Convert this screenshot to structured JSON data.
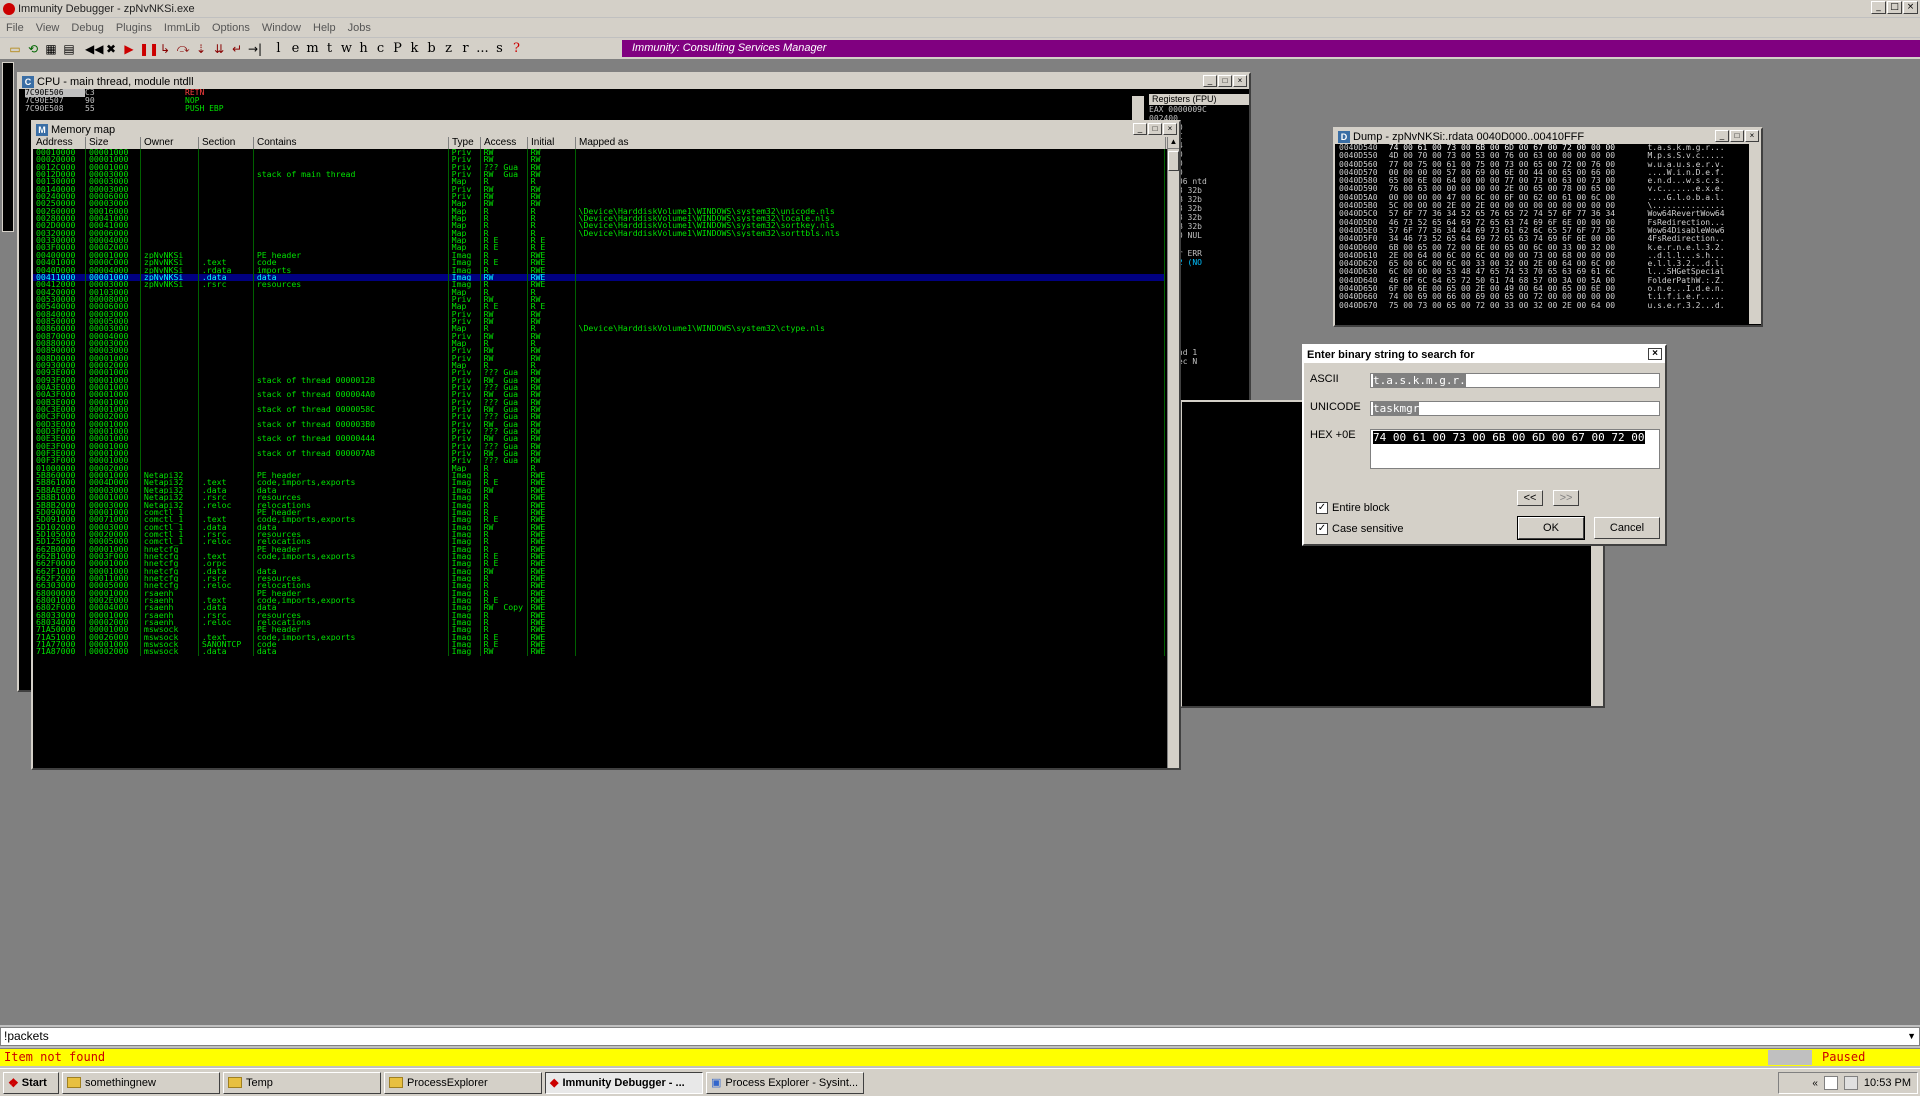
{
  "app": {
    "title": "Immunity Debugger - zpNvNKSi.exe"
  },
  "menu": [
    "File",
    "View",
    "Debug",
    "Plugins",
    "ImmLib",
    "Options",
    "Window",
    "Help",
    "Jobs"
  ],
  "toolbar": {
    "letters": [
      "l",
      "e",
      "m",
      "t",
      "w",
      "h",
      "c",
      "P",
      "k",
      "b",
      "z",
      "r",
      "...",
      "s",
      "?"
    ],
    "banner": "Immunity: Consulting Services Manager"
  },
  "cpu": {
    "title": "CPU - main thread, module ntdll",
    "lines": [
      {
        "addr": "7C90E506",
        "hex": "C3",
        "asm": "RETN"
      },
      {
        "addr": "7C90E507",
        "hex": "90",
        "asm": "NOP"
      },
      {
        "addr": "7C90E508",
        "hex": "55",
        "asm": "PUSH EBP"
      }
    ],
    "reg_header": "Registers (FPU)",
    "regs": [
      "EAX 0000009C",
      "002400",
      "0000000",
      "012FEEC",
      "012FEC4",
      "012FF60",
      "0000000",
      "FFDA000",
      "7C90E506 ntd",
      "ES 0023 32b",
      "CS 001B 32b",
      "SS 0023 32b",
      "DS 0023 32b",
      "FS 003B 32b",
      "GS 0000 NUL",
      "",
      "LastErr ERR",
      "0000302 (NO",
      "mpty",
      "mpty",
      "mpty",
      "mpty",
      "mpty",
      "mpty",
      "mpty",
      "mpty",
      "",
      "320  Cond 1",
      "27F  Prec N"
    ]
  },
  "memmap": {
    "title": "Memory map",
    "columns": [
      "Address",
      "Size",
      "Owner",
      "Section",
      "Contains",
      "Type",
      "Access",
      "Initial",
      "Mapped as"
    ],
    "rows": [
      [
        "00010000",
        "00001000",
        "",
        "",
        "",
        "Priv",
        "RW",
        "RW",
        ""
      ],
      [
        "00020000",
        "00001000",
        "",
        "",
        "",
        "Priv",
        "RW",
        "RW",
        ""
      ],
      [
        "0012C000",
        "00001000",
        "",
        "",
        "",
        "Priv",
        "??? Gua",
        "RW",
        ""
      ],
      [
        "0012D000",
        "00003000",
        "",
        "",
        "stack of main thread",
        "Priv",
        "RW  Gua",
        "RW",
        ""
      ],
      [
        "00130000",
        "00003000",
        "",
        "",
        "",
        "Map",
        "R",
        "R",
        ""
      ],
      [
        "00140000",
        "00003000",
        "",
        "",
        "",
        "Priv",
        "RW",
        "RW",
        ""
      ],
      [
        "00240000",
        "00006000",
        "",
        "",
        "",
        "Priv",
        "RW",
        "RW",
        ""
      ],
      [
        "00250000",
        "00003000",
        "",
        "",
        "",
        "Map",
        "RW",
        "RW",
        ""
      ],
      [
        "00260000",
        "00016000",
        "",
        "",
        "",
        "Map",
        "R",
        "R",
        "\\Device\\HarddiskVolume1\\WINDOWS\\system32\\unicode.nls"
      ],
      [
        "00280000",
        "00041000",
        "",
        "",
        "",
        "Map",
        "R",
        "R",
        "\\Device\\HarddiskVolume1\\WINDOWS\\system32\\locale.nls"
      ],
      [
        "002D0000",
        "00041000",
        "",
        "",
        "",
        "Map",
        "R",
        "R",
        "\\Device\\HarddiskVolume1\\WINDOWS\\system32\\sortkey.nls"
      ],
      [
        "00320000",
        "00006000",
        "",
        "",
        "",
        "Map",
        "R",
        "R",
        "\\Device\\HarddiskVolume1\\WINDOWS\\system32\\sorttbls.nls"
      ],
      [
        "00330000",
        "00004000",
        "",
        "",
        "",
        "Map",
        "R E",
        "R E",
        ""
      ],
      [
        "003F0000",
        "00002000",
        "",
        "",
        "",
        "Map",
        "R E",
        "R E",
        ""
      ],
      [
        "00400000",
        "00001000",
        "zpNvNKSi",
        "",
        "PE header",
        "Imag",
        "R",
        "RWE",
        ""
      ],
      [
        "00401000",
        "0000C000",
        "zpNvNKSi",
        ".text",
        "code",
        "Imag",
        "R E",
        "RWE",
        ""
      ],
      [
        "0040D000",
        "00004000",
        "zpNvNKSi",
        ".rdata",
        "imports",
        "Imag",
        "R",
        "RWE",
        ""
      ],
      [
        "00411000",
        "00001000",
        "zpNvNKSi",
        ".data",
        "data",
        "Imag",
        "RW",
        "RWE",
        ""
      ],
      [
        "00412000",
        "00003000",
        "zpNvNKSi",
        ".rsrc",
        "resources",
        "Imag",
        "R",
        "RWE",
        ""
      ],
      [
        "00420000",
        "00103000",
        "",
        "",
        "",
        "Map",
        "R",
        "R",
        ""
      ],
      [
        "00530000",
        "00008000",
        "",
        "",
        "",
        "Priv",
        "RW",
        "RW",
        ""
      ],
      [
        "00540000",
        "00006000",
        "",
        "",
        "",
        "Map",
        "R E",
        "R E",
        ""
      ],
      [
        "00840000",
        "00003000",
        "",
        "",
        "",
        "Priv",
        "RW",
        "RW",
        ""
      ],
      [
        "00850000",
        "00005000",
        "",
        "",
        "",
        "Priv",
        "RW",
        "RW",
        ""
      ],
      [
        "00860000",
        "00003000",
        "",
        "",
        "",
        "Map",
        "R",
        "R",
        "\\Device\\HarddiskVolume1\\WINDOWS\\system32\\ctype.nls"
      ],
      [
        "00870000",
        "00004000",
        "",
        "",
        "",
        "Priv",
        "RW",
        "RW",
        ""
      ],
      [
        "00880000",
        "00003000",
        "",
        "",
        "",
        "Map",
        "R",
        "R",
        ""
      ],
      [
        "00890000",
        "00003000",
        "",
        "",
        "",
        "Priv",
        "RW",
        "RW",
        ""
      ],
      [
        "008D0000",
        "00001000",
        "",
        "",
        "",
        "Priv",
        "RW",
        "RW",
        ""
      ],
      [
        "00930000",
        "00002000",
        "",
        "",
        "",
        "Map",
        "R",
        "R",
        ""
      ],
      [
        "0093E000",
        "00001000",
        "",
        "",
        "",
        "Priv",
        "??? Gua",
        "RW",
        ""
      ],
      [
        "0093F000",
        "00001000",
        "",
        "",
        "stack of thread 00000128",
        "Priv",
        "RW  Gua",
        "RW",
        ""
      ],
      [
        "00A3E000",
        "00001000",
        "",
        "",
        "",
        "Priv",
        "??? Gua",
        "RW",
        ""
      ],
      [
        "00A3F000",
        "00001000",
        "",
        "",
        "stack of thread 000004A0",
        "Priv",
        "RW  Gua",
        "RW",
        ""
      ],
      [
        "00B3E000",
        "00001000",
        "",
        "",
        "",
        "Priv",
        "??? Gua",
        "RW",
        ""
      ],
      [
        "00C3E000",
        "00001000",
        "",
        "",
        "stack of thread 0000058C",
        "Priv",
        "RW  Gua",
        "RW",
        ""
      ],
      [
        "00C3F000",
        "00002000",
        "",
        "",
        "",
        "Priv",
        "??? Gua",
        "RW",
        ""
      ],
      [
        "00D3E000",
        "00001000",
        "",
        "",
        "stack of thread 000003B0",
        "Priv",
        "RW  Gua",
        "RW",
        ""
      ],
      [
        "00D3F000",
        "00001000",
        "",
        "",
        "",
        "Priv",
        "??? Gua",
        "RW",
        ""
      ],
      [
        "00E3E000",
        "00001000",
        "",
        "",
        "stack of thread 00000444",
        "Priv",
        "RW  Gua",
        "RW",
        ""
      ],
      [
        "00E3F000",
        "00001000",
        "",
        "",
        "",
        "Priv",
        "??? Gua",
        "RW",
        ""
      ],
      [
        "00F3E000",
        "00001000",
        "",
        "",
        "stack of thread 000007A8",
        "Priv",
        "RW  Gua",
        "RW",
        ""
      ],
      [
        "00F3F000",
        "00001000",
        "",
        "",
        "",
        "Priv",
        "??? Gua",
        "RW",
        ""
      ],
      [
        "01000000",
        "00002000",
        "",
        "",
        "",
        "Map",
        "R",
        "R",
        ""
      ],
      [
        "5B860000",
        "00001000",
        "Netapi32",
        "",
        "PE header",
        "Imag",
        "R",
        "RWE",
        ""
      ],
      [
        "5B861000",
        "0004D000",
        "Netapi32",
        ".text",
        "code,imports,exports",
        "Imag",
        "R E",
        "RWE",
        ""
      ],
      [
        "5B8AE000",
        "00003000",
        "Netapi32",
        ".data",
        "data",
        "Imag",
        "RW",
        "RWE",
        ""
      ],
      [
        "5B8B1000",
        "00001000",
        "Netapi32",
        ".rsrc",
        "resources",
        "Imag",
        "R",
        "RWE",
        ""
      ],
      [
        "5B8B2000",
        "00003000",
        "Netapi32",
        ".reloc",
        "relocations",
        "Imag",
        "R",
        "RWE",
        ""
      ],
      [
        "5D090000",
        "00001000",
        "comctl_1",
        "",
        "PE header",
        "Imag",
        "R",
        "RWE",
        ""
      ],
      [
        "5D091000",
        "00071000",
        "comctl_1",
        ".text",
        "code,imports,exports",
        "Imag",
        "R E",
        "RWE",
        ""
      ],
      [
        "5D102000",
        "00003000",
        "comctl_1",
        ".data",
        "data",
        "Imag",
        "RW",
        "RWE",
        ""
      ],
      [
        "5D105000",
        "00020000",
        "comctl_1",
        ".rsrc",
        "resources",
        "Imag",
        "R",
        "RWE",
        ""
      ],
      [
        "5D125000",
        "00005000",
        "comctl_1",
        ".reloc",
        "relocations",
        "Imag",
        "R",
        "RWE",
        ""
      ],
      [
        "662B0000",
        "00001000",
        "hnetcfg",
        "",
        "PE header",
        "Imag",
        "R",
        "RWE",
        ""
      ],
      [
        "662B1000",
        "0003F000",
        "hnetcfg",
        ".text",
        "code,imports,exports",
        "Imag",
        "R E",
        "RWE",
        ""
      ],
      [
        "662F0000",
        "00001000",
        "hnetcfg",
        ".orpc",
        "",
        "Imag",
        "R E",
        "RWE",
        ""
      ],
      [
        "662F1000",
        "00001000",
        "hnetcfg",
        ".data",
        "data",
        "Imag",
        "RW",
        "RWE",
        ""
      ],
      [
        "662F2000",
        "00011000",
        "hnetcfg",
        ".rsrc",
        "resources",
        "Imag",
        "R",
        "RWE",
        ""
      ],
      [
        "66303000",
        "00005000",
        "hnetcfg",
        ".reloc",
        "relocations",
        "Imag",
        "R",
        "RWE",
        ""
      ],
      [
        "68000000",
        "00001000",
        "rsaenh",
        "",
        "PE header",
        "Imag",
        "R",
        "RWE",
        ""
      ],
      [
        "68001000",
        "0002E000",
        "rsaenh",
        ".text",
        "code,imports,exports",
        "Imag",
        "R E",
        "RWE",
        ""
      ],
      [
        "6802F000",
        "00004000",
        "rsaenh",
        ".data",
        "data",
        "Imag",
        "RW  Copy",
        "RWE",
        ""
      ],
      [
        "68033000",
        "00001000",
        "rsaenh",
        ".rsrc",
        "resources",
        "Imag",
        "R",
        "RWE",
        ""
      ],
      [
        "68034000",
        "00002000",
        "rsaenh",
        ".reloc",
        "relocations",
        "Imag",
        "R",
        "RWE",
        ""
      ],
      [
        "71A50000",
        "00001000",
        "mswsock",
        "",
        "PE header",
        "Imag",
        "R",
        "RWE",
        ""
      ],
      [
        "71A51000",
        "00026000",
        "mswsock",
        ".text",
        "code,imports,exports",
        "Imag",
        "R E",
        "RWE",
        ""
      ],
      [
        "71A77000",
        "00001000",
        "mswsock",
        "SANONTCP",
        "code",
        "Imag",
        "R E",
        "RWE",
        ""
      ],
      [
        "71A87000",
        "00002000",
        "mswsock",
        ".data",
        "data",
        "Imag",
        "RW",
        "RWE",
        ""
      ]
    ]
  },
  "dump": {
    "title": "Dump - zpNvNKSi:.rdata 0040D000..00410FFF",
    "rows": [
      [
        "0040D540",
        "74 00 61 00 73 00 6B 00 6D 00 67 00 72 00 00 00",
        "t.a.s.k.m.g.r..."
      ],
      [
        "0040D550",
        "4D 00 70 00 73 00 53 00 76 00 63 00 00 00 00 00",
        "M.p.s.S.v.c....."
      ],
      [
        "0040D560",
        "77 00 75 00 61 00 75 00 73 00 65 00 72 00 76 00",
        "w.u.a.u.s.e.r.v."
      ],
      [
        "0040D570",
        "00 00 00 00 57 00 69 00 6E 00 44 00 65 00 66 00",
        "....W.i.n.D.e.f."
      ],
      [
        "0040D580",
        "65 00 6E 00 64 00 00 00 77 00 73 00 63 00 73 00",
        "e.n.d...w.s.c.s."
      ],
      [
        "0040D590",
        "76 00 63 00 00 00 00 00 2E 00 65 00 78 00 65 00",
        "v.c.......e.x.e."
      ],
      [
        "0040D5A0",
        "00 00 00 00 47 00 6C 00 6F 00 62 00 61 00 6C 00",
        "....G.l.o.b.a.l."
      ],
      [
        "0040D5B0",
        "5C 00 00 00 2E 00 2E 00 00 00 00 00 00 00 00 00",
        "\\..............."
      ],
      [
        "0040D5C0",
        "57 6F 77 36 34 52 65 76 65 72 74 57 6F 77 36 34",
        "Wow64RevertWow64"
      ],
      [
        "0040D5D0",
        "46 73 52 65 64 69 72 65 63 74 69 6F 6E 00 00 00",
        "FsRedirection..."
      ],
      [
        "0040D5E0",
        "57 6F 77 36 34 44 69 73 61 62 6C 65 57 6F 77 36",
        "Wow64DisableWow6"
      ],
      [
        "0040D5F0",
        "34 46 73 52 65 64 69 72 65 63 74 69 6F 6E 00 00",
        "4FsRedirection.."
      ],
      [
        "0040D600",
        "6B 00 65 00 72 00 6E 00 65 00 6C 00 33 00 32 00",
        "k.e.r.n.e.l.3.2."
      ],
      [
        "0040D610",
        "2E 00 64 00 6C 00 6C 00 00 00 73 00 68 00 00 00",
        "..d.l.l...s.h..."
      ],
      [
        "0040D620",
        "65 00 6C 00 6C 00 33 00 32 00 2E 00 64 00 6C 00",
        "e.l.l.3.2...d.l."
      ],
      [
        "0040D630",
        "6C 00 00 00 53 48 47 65 74 53 70 65 63 69 61 6C",
        "l...SHGetSpecial"
      ],
      [
        "0040D640",
        "46 6F 6C 64 65 72 50 61 74 68 57 00 3A 00 5A 00",
        "FolderPathW.:.Z."
      ],
      [
        "0040D650",
        "6F 00 6E 00 65 00 2E 00 49 00 64 00 65 00 6E 00",
        "o.n.e...I.d.e.n."
      ],
      [
        "0040D660",
        "74 00 69 00 66 00 69 00 65 00 72 00 00 00 00 00",
        "t.i.f.i.e.r....."
      ],
      [
        "0040D670",
        "75 00 73 00 65 00 72 00 33 00 32 00 2E 00 64 00",
        "u.s.e.r.3.2...d."
      ]
    ]
  },
  "dialog": {
    "title": "Enter binary string to search for",
    "ascii_label": "ASCII",
    "ascii_value": "t.a.s.k.m.g.r.",
    "unicode_label": "UNICODE",
    "unicode_value": "taskmgr",
    "hex_label": "HEX +0E",
    "hex_value": "74 00 61 00 73 00 6B 00 6D 00 67 00 72 00",
    "prev": "<<",
    "next": ">>",
    "entire_block": "Entire block",
    "case_sensitive": "Case sensitive",
    "ok": "OK",
    "cancel": "Cancel"
  },
  "command": "!packets",
  "status": {
    "message": "Item not found",
    "state": "Paused"
  },
  "taskbar": {
    "start": "Start",
    "tasks": [
      "somethingnew",
      "Temp",
      "ProcessExplorer",
      "Immunity Debugger - ...",
      "Process Explorer - Sysint..."
    ],
    "clock": "10:53 PM"
  }
}
